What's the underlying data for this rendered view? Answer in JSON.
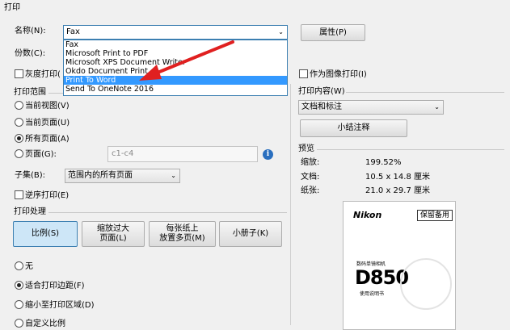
{
  "window": {
    "title": "打印"
  },
  "printer": {
    "name_label": "名称(N):",
    "selected": "Fax",
    "properties_button": "属性(P)",
    "copies_label": "份数(C):",
    "grayscale_label": "灰度打印(",
    "print_as_image_label": "作为图像打印(I)",
    "options": [
      "Fax",
      "Microsoft Print to PDF",
      "Microsoft XPS Document Writer",
      "Okdo Document Print",
      "Print To Word",
      "Send To OneNote 2016"
    ],
    "highlighted_index": 4
  },
  "print_range": {
    "title": "打印范围",
    "current_view": "当前视图(V)",
    "current_page": "当前页面(U)",
    "all_pages": "所有页面(A)",
    "pages_label": "页面(G):",
    "pages_value": "c1-c4",
    "subset_label": "子集(B):",
    "subset_value": "范围内的所有页面",
    "reverse_label": "逆序打印(E)"
  },
  "print_content": {
    "title": "打印内容(W)",
    "value": "文档和标注",
    "summarize_button": "小结注释"
  },
  "preview": {
    "title": "预览",
    "zoom_label": "缩放:",
    "zoom_value": "199.52%",
    "doc_label": "文档:",
    "doc_value": "10.5 x 14.8 厘米",
    "paper_label": "纸张:",
    "paper_value": "21.0 x 29.7 厘米",
    "page": {
      "brand": "Nikon",
      "badge": "保留备用",
      "line1": "数码单镜相机",
      "model": "D850",
      "line2": "使用说明书"
    }
  },
  "handling": {
    "title": "打印处理",
    "buttons": [
      "比例(S)",
      "缩放过大\n页面(L)",
      "每张纸上\n放置多页(M)",
      "小册子(K)"
    ],
    "none_label": "无",
    "fit_label": "适合打印边距(F)",
    "shrink_label": "缩小至打印区域(D)",
    "custom_label": "自定义比例"
  }
}
